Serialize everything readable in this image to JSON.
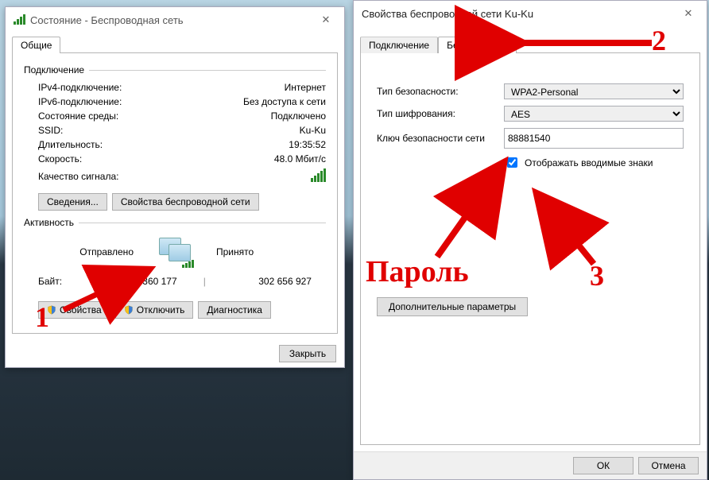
{
  "dlg1": {
    "title": "Состояние - Беспроводная сеть",
    "tab_general": "Общие",
    "sec_connection": "Подключение",
    "ipv4_k": "IPv4-подключение:",
    "ipv4_v": "Интернет",
    "ipv6_k": "IPv6-подключение:",
    "ipv6_v": "Без доступа к сети",
    "media_k": "Состояние среды:",
    "media_v": "Подключено",
    "ssid_k": "SSID:",
    "ssid_v": "Ku-Ku",
    "dur_k": "Длительность:",
    "dur_v": "19:35:52",
    "speed_k": "Скорость:",
    "speed_v": "48.0 Мбит/с",
    "sigq": "Качество сигнала:",
    "btn_details": "Сведения...",
    "btn_props": "Свойства беспроводной сети",
    "sec_activity": "Активность",
    "sent": "Отправлено",
    "recv": "Принято",
    "bytes_k": "Байт:",
    "bytes_sent": "90 360 177",
    "bytes_recv": "302 656 927",
    "btn_cprops": "Свойства",
    "btn_disable": "Отключить",
    "btn_diag": "Диагностика",
    "btn_close": "Закрыть"
  },
  "dlg2": {
    "title": "Свойства беспроводной сети Ku-Ku",
    "tab_conn": "Подключение",
    "tab_sec": "Безопасность",
    "sectype_k": "Тип безопасности:",
    "sectype_v": "WPA2-Personal",
    "enc_k": "Тип шифрования:",
    "enc_v": "AES",
    "key_k": "Ключ безопасности сети",
    "key_v": "88881540",
    "showchars": "Отображать вводимые знаки",
    "btn_adv": "Дополнительные параметры",
    "btn_ok": "ОК",
    "btn_cancel": "Отмена"
  },
  "ann": {
    "n1": "1",
    "n2": "2",
    "n3": "3",
    "pwd": "Пароль"
  }
}
